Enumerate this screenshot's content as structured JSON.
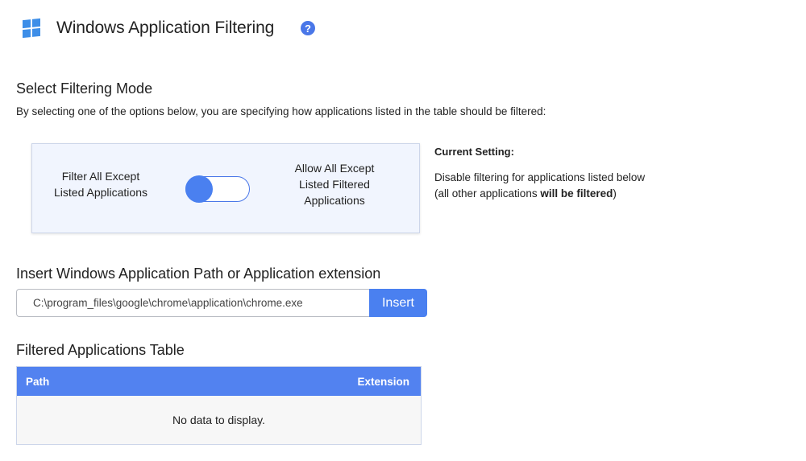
{
  "header": {
    "title": "Windows Application Filtering",
    "logo_icon": "windows-logo-icon",
    "help_icon": "question-circle-icon",
    "help_glyph": "?"
  },
  "filter_mode": {
    "title": "Select Filtering Mode",
    "description": "By selecting one of the options below, you are specifying how applications listed in the table should be filtered:",
    "left_option": "Filter All Except Listed Applications",
    "right_option": "Allow All Except Listed Filtered Applications",
    "toggle_state": "left",
    "current_setting_label": "Current Setting:",
    "current_setting_line1": "Disable filtering for applications listed below",
    "current_setting_line2_prefix": "(all other applications ",
    "current_setting_line2_bold": "will be filtered",
    "current_setting_line2_suffix": ")"
  },
  "insert": {
    "title": "Insert Windows Application Path or Application extension",
    "input_value": "C:\\program_files\\google\\chrome\\application\\chrome.exe",
    "button_label": "Insert"
  },
  "table": {
    "title": "Filtered Applications Table",
    "columns": [
      "Path",
      "Extension"
    ],
    "empty_text": "No data to display."
  },
  "colors": {
    "accent": "#4a80f0",
    "table_header": "#5282f0",
    "panel_bg": "#f1f5fe"
  }
}
